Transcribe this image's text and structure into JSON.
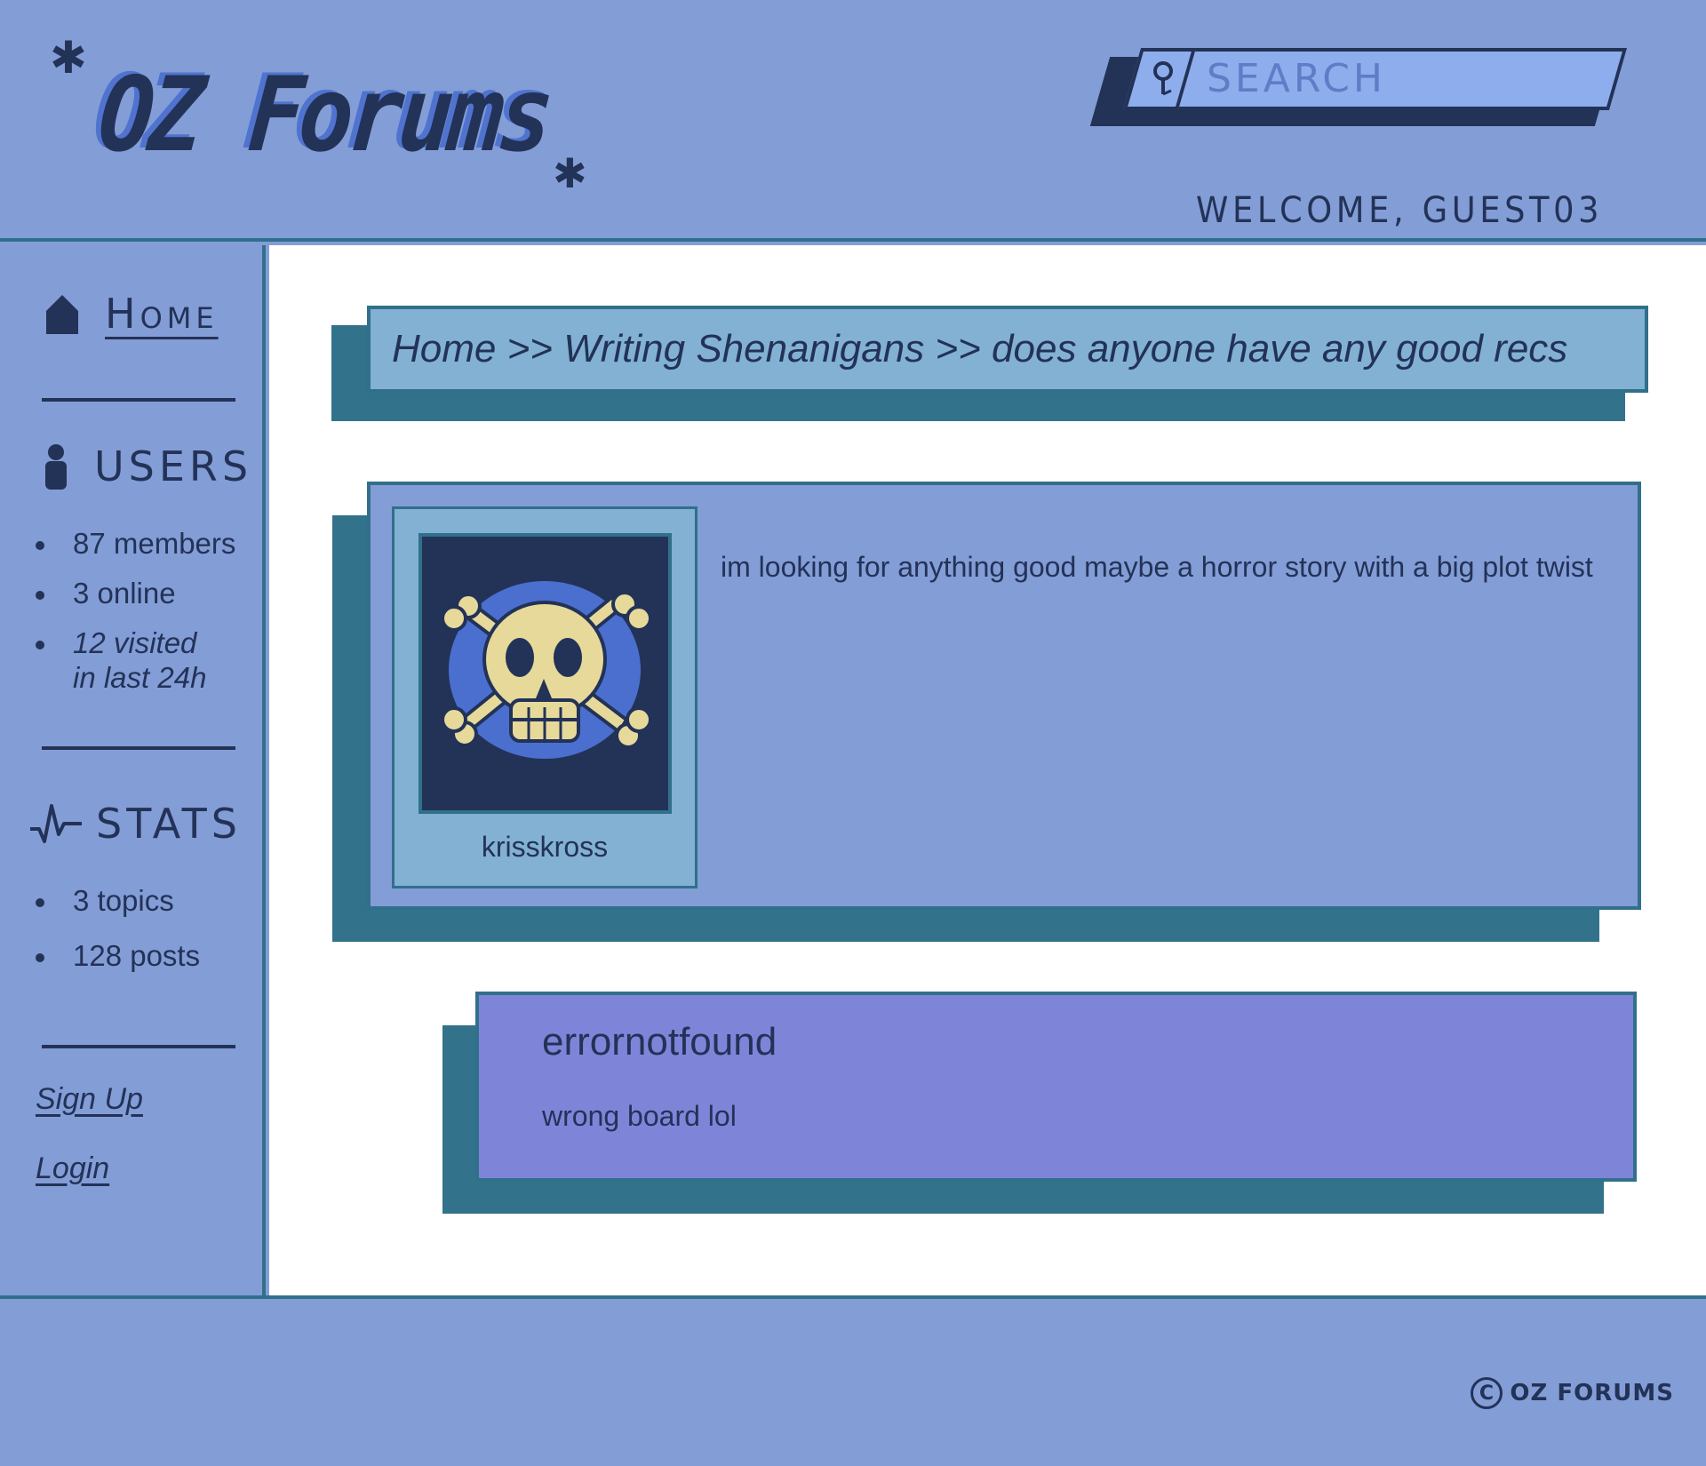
{
  "header": {
    "logo": "OZ Forums",
    "search_placeholder": "Search",
    "welcome": "Welcome, Guest03"
  },
  "sidebar": {
    "home_label": "Home",
    "users_label": "Users",
    "users_stats": [
      "87 members",
      "3 online",
      "12 visited in last 24h"
    ],
    "stats_label": "Stats",
    "stats_items": [
      "3 topics",
      "128 posts"
    ],
    "sign_up": "Sign Up",
    "login": "Login"
  },
  "breadcrumb": "Home >> Writing Shenanigans >> does anyone have any good recs",
  "post": {
    "username": "krisskross",
    "body": "im looking for anything good maybe a horror story with a big plot twist"
  },
  "reply": {
    "username": "errornotfound",
    "body": "wrong board lol"
  },
  "footer": {
    "copyright": "OZ Forums"
  },
  "colors": {
    "background": "#839dd6",
    "dark": "#233257",
    "accent_teal": "#33728b",
    "breadcrumb_bg": "#82b1d3",
    "reply_bg": "#7e85d9",
    "search_bg": "#8eadec"
  },
  "icons": [
    "star-icon",
    "search-icon",
    "home-icon",
    "user-icon",
    "activity-icon",
    "skull-crossbones-icon",
    "copyright-icon"
  ]
}
